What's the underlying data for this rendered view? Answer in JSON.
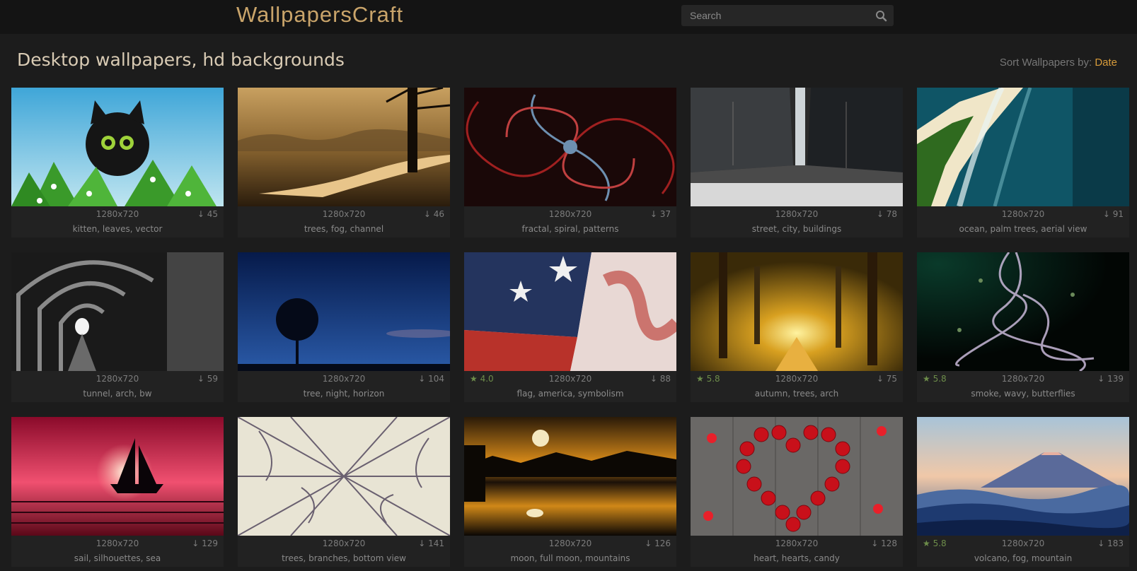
{
  "header": {
    "logo": "WallpapersCraft",
    "search_placeholder": "Search"
  },
  "page_title": "Desktop wallpapers, hd backgrounds",
  "sort": {
    "label": "Sort Wallpapers by:",
    "value": "Date"
  },
  "wallpapers": [
    {
      "resolution": "1280x720",
      "downloads": "45",
      "rating": "",
      "tags": "kitten, leaves, vector"
    },
    {
      "resolution": "1280x720",
      "downloads": "46",
      "rating": "",
      "tags": "trees, fog, channel"
    },
    {
      "resolution": "1280x720",
      "downloads": "37",
      "rating": "",
      "tags": "fractal, spiral, patterns"
    },
    {
      "resolution": "1280x720",
      "downloads": "78",
      "rating": "",
      "tags": "street, city, buildings"
    },
    {
      "resolution": "1280x720",
      "downloads": "91",
      "rating": "",
      "tags": "ocean, palm trees, aerial view"
    },
    {
      "resolution": "1280x720",
      "downloads": "59",
      "rating": "",
      "tags": "tunnel, arch, bw"
    },
    {
      "resolution": "1280x720",
      "downloads": "104",
      "rating": "",
      "tags": "tree, night, horizon"
    },
    {
      "resolution": "1280x720",
      "downloads": "88",
      "rating": "4.0",
      "tags": "flag, america, symbolism"
    },
    {
      "resolution": "1280x720",
      "downloads": "75",
      "rating": "5.8",
      "tags": "autumn, trees, arch"
    },
    {
      "resolution": "1280x720",
      "downloads": "139",
      "rating": "5.8",
      "tags": "smoke, wavy, butterflies"
    },
    {
      "resolution": "1280x720",
      "downloads": "129",
      "rating": "",
      "tags": "sail, silhouettes, sea"
    },
    {
      "resolution": "1280x720",
      "downloads": "141",
      "rating": "",
      "tags": "trees, branches, bottom view"
    },
    {
      "resolution": "1280x720",
      "downloads": "126",
      "rating": "",
      "tags": "moon, full moon, mountains"
    },
    {
      "resolution": "1280x720",
      "downloads": "128",
      "rating": "",
      "tags": "heart, hearts, candy"
    },
    {
      "resolution": "1280x720",
      "downloads": "183",
      "rating": "5.8",
      "tags": "volcano, fog, mountain"
    }
  ],
  "icons": {
    "search": "search-icon",
    "download": "download-icon",
    "star": "star-icon"
  },
  "colors": {
    "accent": "#d79b3a",
    "logo": "#c9a46a",
    "rating": "#6d8d4a"
  }
}
